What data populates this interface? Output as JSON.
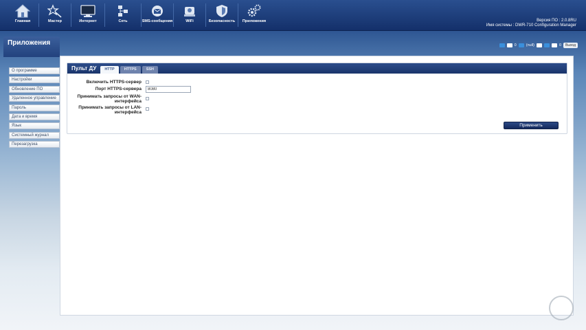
{
  "nav": {
    "items": [
      {
        "label": "Главная",
        "icon": "home-icon"
      },
      {
        "label": "Мастер",
        "icon": "wizard-icon"
      },
      {
        "label": "Интернет",
        "icon": "monitor-icon"
      },
      {
        "label": "Сеть",
        "icon": "network-icon"
      },
      {
        "label": "SMS-сообщения",
        "icon": "envelope-icon"
      },
      {
        "label": "WiFi",
        "icon": "wifi-router-icon"
      },
      {
        "label": "Безопасность",
        "icon": "shield-icon"
      },
      {
        "label": "Приложения",
        "icon": "gears-icon"
      }
    ]
  },
  "system": {
    "firmware": "Версия ПО : 2.0.8RU",
    "name": "Имя системы : DWR-710 Configuration Manager"
  },
  "status": {
    "sms_count": "0",
    "signal": "(null)",
    "wifi_count": "0",
    "exit_label": "Выход"
  },
  "page_title": "Приложения",
  "sidebar": {
    "items": [
      {
        "label": "О программе"
      },
      {
        "label": "Настройки"
      },
      {
        "label": "Обновление ПО"
      },
      {
        "label": "Удаленное управление"
      },
      {
        "label": "Пароль"
      },
      {
        "label": "Дата и время"
      },
      {
        "label": "Язык"
      },
      {
        "label": "Системный журнал"
      },
      {
        "label": "Перезагрузка"
      }
    ]
  },
  "panel": {
    "title": "Пульт ДУ",
    "tabs": [
      {
        "label": "HTTP",
        "active": true
      },
      {
        "label": "HTTPS",
        "active": false
      },
      {
        "label": "SSH",
        "active": false
      }
    ],
    "fields": {
      "enable_https": "Включить HTTPS-сервер",
      "https_port": "Порт HTTPS-сервера",
      "https_port_value": "8080",
      "wan_requests": "Принимать запросы от WAN-интерфейса",
      "lan_requests": "Принимать запросы от LAN-интерфейса"
    },
    "apply_label": "Применить"
  }
}
